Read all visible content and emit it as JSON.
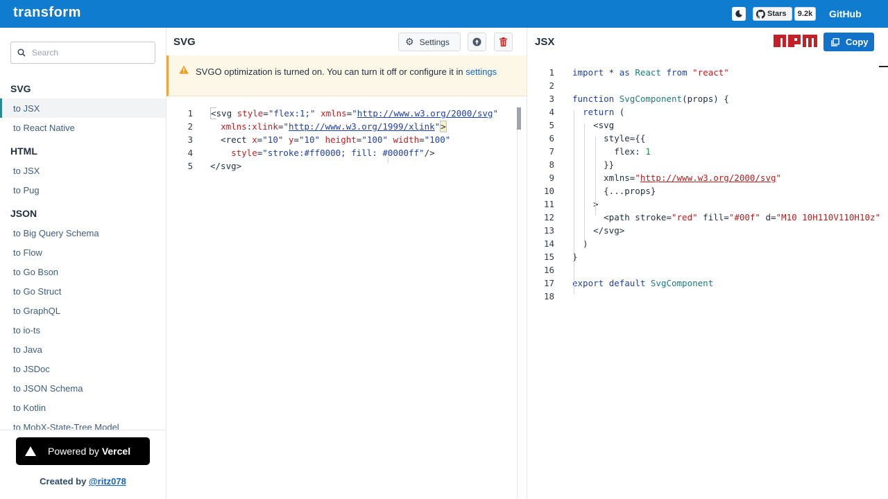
{
  "header": {
    "brand": "transform",
    "stars_label": "Stars",
    "stars_count": "9.2k",
    "github_label": "GitHub",
    "accent_color": "#0f7cd0"
  },
  "sidebar": {
    "search_placeholder": "Search",
    "groups": [
      {
        "heading": "SVG",
        "items": [
          "to JSX",
          "to React Native"
        ]
      },
      {
        "heading": "HTML",
        "items": [
          "to JSX",
          "to Pug"
        ]
      },
      {
        "heading": "JSON",
        "items": [
          "to Big Query Schema",
          "to Flow",
          "to Go Bson",
          "to Go Struct",
          "to GraphQL",
          "to io-ts",
          "to Java",
          "to JSDoc",
          "to JSON Schema",
          "to Kotlin",
          "to MobX-State-Tree Model"
        ]
      }
    ],
    "active_item": "to JSX",
    "powered_by_prefix": "Powered by",
    "powered_by_brand": "Vercel",
    "created_by_prefix": "Created by",
    "created_by_handle": "@ritz078"
  },
  "svg_panel": {
    "title": "SVG",
    "settings_label": "Settings",
    "warning_text": "SVGO optimization is turned on. You can turn it off or configure it in",
    "warning_link": "settings",
    "line_numbers": [
      "1",
      "2",
      "3",
      "4",
      "5"
    ]
  },
  "jsx_panel": {
    "title": "JSX",
    "copy_label": "Copy",
    "npm_label": "npm",
    "line_numbers": [
      "1",
      "2",
      "3",
      "4",
      "5",
      "6",
      "7",
      "8",
      "9",
      "10",
      "11",
      "12",
      "13",
      "14",
      "15",
      "16",
      "17",
      "18"
    ]
  }
}
